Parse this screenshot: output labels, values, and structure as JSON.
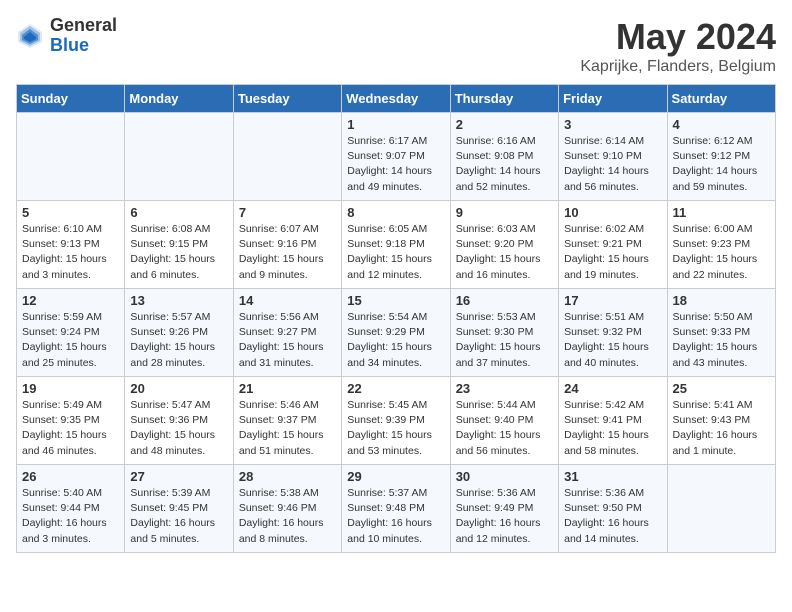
{
  "logo": {
    "general": "General",
    "blue": "Blue"
  },
  "title": "May 2024",
  "subtitle": "Kaprijke, Flanders, Belgium",
  "headers": [
    "Sunday",
    "Monday",
    "Tuesday",
    "Wednesday",
    "Thursday",
    "Friday",
    "Saturday"
  ],
  "weeks": [
    [
      {
        "day": "",
        "info": ""
      },
      {
        "day": "",
        "info": ""
      },
      {
        "day": "",
        "info": ""
      },
      {
        "day": "1",
        "info": "Sunrise: 6:17 AM\nSunset: 9:07 PM\nDaylight: 14 hours\nand 49 minutes."
      },
      {
        "day": "2",
        "info": "Sunrise: 6:16 AM\nSunset: 9:08 PM\nDaylight: 14 hours\nand 52 minutes."
      },
      {
        "day": "3",
        "info": "Sunrise: 6:14 AM\nSunset: 9:10 PM\nDaylight: 14 hours\nand 56 minutes."
      },
      {
        "day": "4",
        "info": "Sunrise: 6:12 AM\nSunset: 9:12 PM\nDaylight: 14 hours\nand 59 minutes."
      }
    ],
    [
      {
        "day": "5",
        "info": "Sunrise: 6:10 AM\nSunset: 9:13 PM\nDaylight: 15 hours\nand 3 minutes."
      },
      {
        "day": "6",
        "info": "Sunrise: 6:08 AM\nSunset: 9:15 PM\nDaylight: 15 hours\nand 6 minutes."
      },
      {
        "day": "7",
        "info": "Sunrise: 6:07 AM\nSunset: 9:16 PM\nDaylight: 15 hours\nand 9 minutes."
      },
      {
        "day": "8",
        "info": "Sunrise: 6:05 AM\nSunset: 9:18 PM\nDaylight: 15 hours\nand 12 minutes."
      },
      {
        "day": "9",
        "info": "Sunrise: 6:03 AM\nSunset: 9:20 PM\nDaylight: 15 hours\nand 16 minutes."
      },
      {
        "day": "10",
        "info": "Sunrise: 6:02 AM\nSunset: 9:21 PM\nDaylight: 15 hours\nand 19 minutes."
      },
      {
        "day": "11",
        "info": "Sunrise: 6:00 AM\nSunset: 9:23 PM\nDaylight: 15 hours\nand 22 minutes."
      }
    ],
    [
      {
        "day": "12",
        "info": "Sunrise: 5:59 AM\nSunset: 9:24 PM\nDaylight: 15 hours\nand 25 minutes."
      },
      {
        "day": "13",
        "info": "Sunrise: 5:57 AM\nSunset: 9:26 PM\nDaylight: 15 hours\nand 28 minutes."
      },
      {
        "day": "14",
        "info": "Sunrise: 5:56 AM\nSunset: 9:27 PM\nDaylight: 15 hours\nand 31 minutes."
      },
      {
        "day": "15",
        "info": "Sunrise: 5:54 AM\nSunset: 9:29 PM\nDaylight: 15 hours\nand 34 minutes."
      },
      {
        "day": "16",
        "info": "Sunrise: 5:53 AM\nSunset: 9:30 PM\nDaylight: 15 hours\nand 37 minutes."
      },
      {
        "day": "17",
        "info": "Sunrise: 5:51 AM\nSunset: 9:32 PM\nDaylight: 15 hours\nand 40 minutes."
      },
      {
        "day": "18",
        "info": "Sunrise: 5:50 AM\nSunset: 9:33 PM\nDaylight: 15 hours\nand 43 minutes."
      }
    ],
    [
      {
        "day": "19",
        "info": "Sunrise: 5:49 AM\nSunset: 9:35 PM\nDaylight: 15 hours\nand 46 minutes."
      },
      {
        "day": "20",
        "info": "Sunrise: 5:47 AM\nSunset: 9:36 PM\nDaylight: 15 hours\nand 48 minutes."
      },
      {
        "day": "21",
        "info": "Sunrise: 5:46 AM\nSunset: 9:37 PM\nDaylight: 15 hours\nand 51 minutes."
      },
      {
        "day": "22",
        "info": "Sunrise: 5:45 AM\nSunset: 9:39 PM\nDaylight: 15 hours\nand 53 minutes."
      },
      {
        "day": "23",
        "info": "Sunrise: 5:44 AM\nSunset: 9:40 PM\nDaylight: 15 hours\nand 56 minutes."
      },
      {
        "day": "24",
        "info": "Sunrise: 5:42 AM\nSunset: 9:41 PM\nDaylight: 15 hours\nand 58 minutes."
      },
      {
        "day": "25",
        "info": "Sunrise: 5:41 AM\nSunset: 9:43 PM\nDaylight: 16 hours\nand 1 minute."
      }
    ],
    [
      {
        "day": "26",
        "info": "Sunrise: 5:40 AM\nSunset: 9:44 PM\nDaylight: 16 hours\nand 3 minutes."
      },
      {
        "day": "27",
        "info": "Sunrise: 5:39 AM\nSunset: 9:45 PM\nDaylight: 16 hours\nand 5 minutes."
      },
      {
        "day": "28",
        "info": "Sunrise: 5:38 AM\nSunset: 9:46 PM\nDaylight: 16 hours\nand 8 minutes."
      },
      {
        "day": "29",
        "info": "Sunrise: 5:37 AM\nSunset: 9:48 PM\nDaylight: 16 hours\nand 10 minutes."
      },
      {
        "day": "30",
        "info": "Sunrise: 5:36 AM\nSunset: 9:49 PM\nDaylight: 16 hours\nand 12 minutes."
      },
      {
        "day": "31",
        "info": "Sunrise: 5:36 AM\nSunset: 9:50 PM\nDaylight: 16 hours\nand 14 minutes."
      },
      {
        "day": "",
        "info": ""
      }
    ]
  ]
}
